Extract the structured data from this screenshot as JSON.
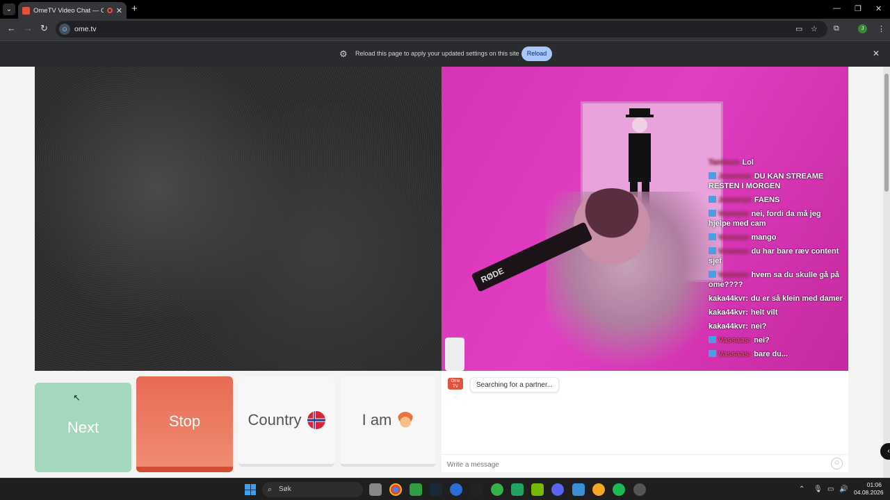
{
  "browser": {
    "tab_title": "OmeTV Video Chat — Ome",
    "new_tab_label": "+",
    "url": "ome.tv",
    "infobar_text": "Reload this page to apply your updated settings on this site",
    "reload_label": "Reload",
    "profile_initial": "J"
  },
  "video": {
    "overlay_chat": [
      {
        "badge": false,
        "user": "Tanhane",
        "user_style": "blur",
        "text": "Lol"
      },
      {
        "badge": true,
        "user": "Jesseran",
        "user_style": "blur",
        "text": "DU KAN STREAME RESTEN I MORGEN"
      },
      {
        "badge": true,
        "user": "Jesseran",
        "user_style": "blur",
        "text": "FAENS"
      },
      {
        "badge": true,
        "user": "Vassaas",
        "user_style": "blur",
        "text": "nei, fordi da må jeg hjelpe med cam"
      },
      {
        "badge": true,
        "user": "Vassaas",
        "user_style": "blur",
        "text": "mango"
      },
      {
        "badge": true,
        "user": "Vassaas",
        "user_style": "blur",
        "text": "du har bare ræv content sjef"
      },
      {
        "badge": true,
        "user": "Vassaas",
        "user_style": "blur",
        "text": "hvem sa du skulle gå på ome????"
      },
      {
        "badge": false,
        "user": "kaka44kvr:",
        "user_style": "white",
        "text": "du er så klein med damer"
      },
      {
        "badge": false,
        "user": "kaka44kvr:",
        "user_style": "white",
        "text": "helt vilt"
      },
      {
        "badge": false,
        "user": "kaka44kvr:",
        "user_style": "white",
        "text": "nei?"
      },
      {
        "badge": true,
        "user": "Vassaas:",
        "user_style": "red",
        "text": "nei?"
      },
      {
        "badge": true,
        "user": "Vassaas:",
        "user_style": "red",
        "text": "bare du..."
      }
    ],
    "mic_brand": "RØDE"
  },
  "controls": {
    "next_label": "Next",
    "stop_label": "Stop",
    "country_label": "Country",
    "iam_label": "I am"
  },
  "chat": {
    "logo_text": "Ome TV",
    "status": "Searching for a partner...",
    "input_placeholder": "Write a message"
  },
  "taskbar": {
    "search_label": "Søk",
    "time": "01:06",
    "date": "04.08.2026"
  },
  "colors": {
    "next": "#a3d8bd",
    "stop": "#e86b54",
    "accent_reload": "#a8c7fa",
    "brand": "#e0533d"
  }
}
